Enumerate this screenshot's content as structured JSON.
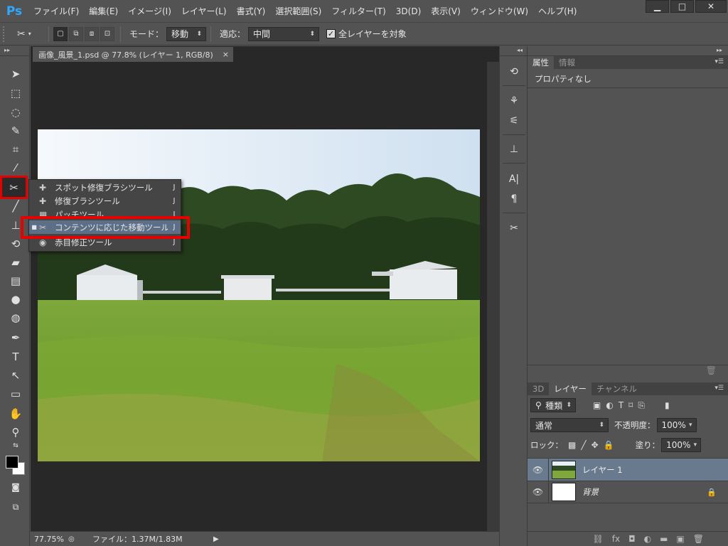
{
  "app": {
    "logo": "Ps"
  },
  "menu": [
    "ファイル(F)",
    "編集(E)",
    "イメージ(I)",
    "レイヤー(L)",
    "書式(Y)",
    "選択範囲(S)",
    "フィルター(T)",
    "3D(D)",
    "表示(V)",
    "ウィンドウ(W)",
    "ヘルプ(H)"
  ],
  "window_controls": {
    "minimize": "▁",
    "maximize": "□",
    "close": "✕"
  },
  "options": {
    "mode_label": "モード：",
    "mode_value": "移動",
    "adapt_label": "適応：",
    "adapt_value": "中間",
    "all_layers_label": "全レイヤーを対象",
    "all_layers_checked": true
  },
  "document": {
    "tab_title": "画像_風景_1.psd @ 77.8% (レイヤー 1, RGB/8)",
    "tab_close": "×",
    "zoom": "77.75%",
    "file_info": "ファイル：1.37M/1.83M"
  },
  "flyout": {
    "items": [
      {
        "icon": "spot-healing-brush-icon",
        "label": "スポット修復ブラシツール",
        "key": "J",
        "selected": false
      },
      {
        "icon": "healing-brush-icon",
        "label": "修復ブラシツール",
        "key": "J",
        "selected": false
      },
      {
        "icon": "patch-icon",
        "label": "パッチツール",
        "key": "J",
        "selected": false
      },
      {
        "icon": "content-aware-move-icon",
        "label": "コンテンツに応じた移動ツール",
        "key": "J",
        "selected": true
      },
      {
        "icon": "red-eye-icon",
        "label": "赤目修正ツール",
        "key": "J",
        "selected": false
      }
    ]
  },
  "properties": {
    "tabs": [
      "属性",
      "情報"
    ],
    "active_tab": "属性",
    "body": "プロパティなし"
  },
  "layers": {
    "tabs": [
      "3D",
      "レイヤー",
      "チャンネル"
    ],
    "active_tab": "レイヤー",
    "filter_value": "種類",
    "blend_mode": "通常",
    "opacity_label": "不透明度：",
    "opacity_value": "100%",
    "lock_label": "ロック：",
    "fill_label": "塗り：",
    "fill_value": "100%",
    "items": [
      {
        "name": "レイヤー 1",
        "selected": true,
        "locked": false
      },
      {
        "name": "背景",
        "selected": false,
        "locked": true
      }
    ]
  },
  "colors": {
    "accent_highlight": "#e60000",
    "selection": "#5c6f87",
    "foreground": "#000000",
    "background": "#ffffff"
  }
}
